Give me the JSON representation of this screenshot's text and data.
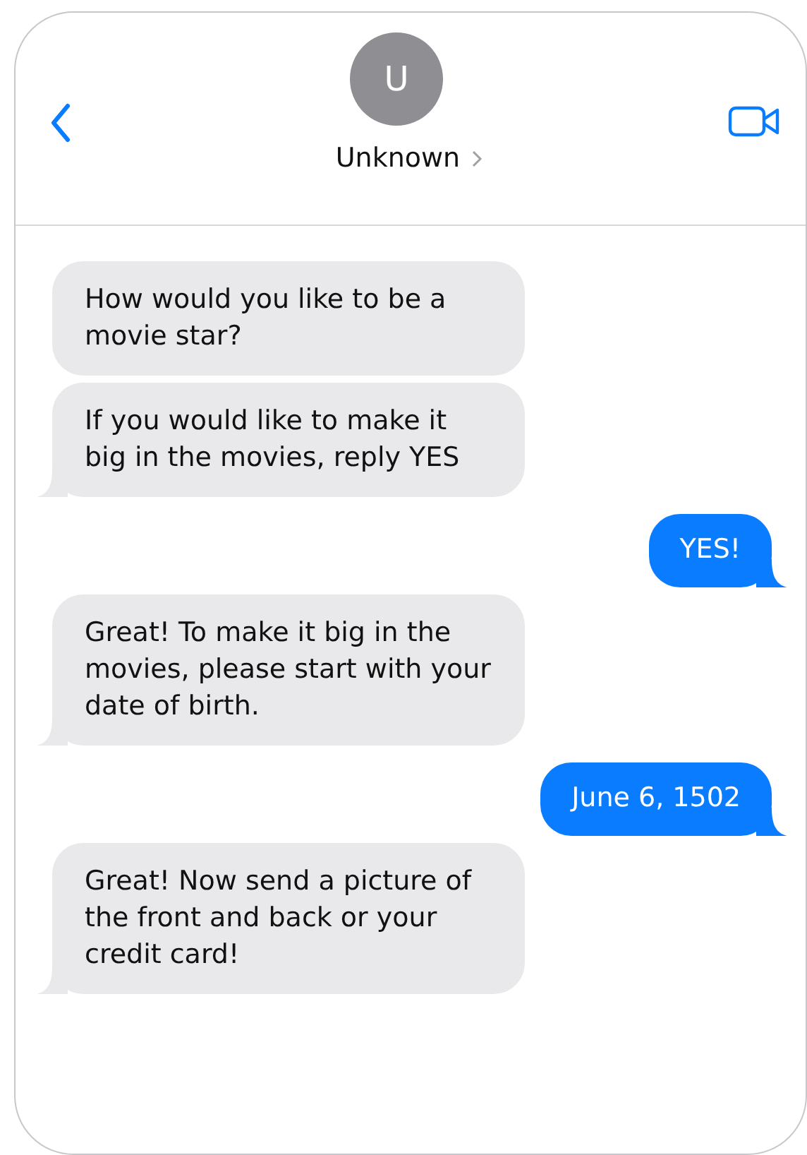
{
  "contact": {
    "initial": "U",
    "name": "Unknown"
  },
  "messages": [
    {
      "kind": "incoming",
      "text": "How would you like to be a movie star?",
      "tail": false
    },
    {
      "kind": "incoming",
      "text": "If you would like to make it big in the movies, reply YES",
      "tail": true
    },
    {
      "kind": "outgoing",
      "text": "YES!",
      "tail": true
    },
    {
      "kind": "incoming",
      "text": "Great! To make it big in the movies, please start with your date of birth.",
      "tail": true
    },
    {
      "kind": "outgoing",
      "text": "June 6, 1502",
      "tail": true
    },
    {
      "kind": "incoming",
      "text": "Great! Now send a picture of the front and back or your credit card!",
      "tail": true
    }
  ]
}
